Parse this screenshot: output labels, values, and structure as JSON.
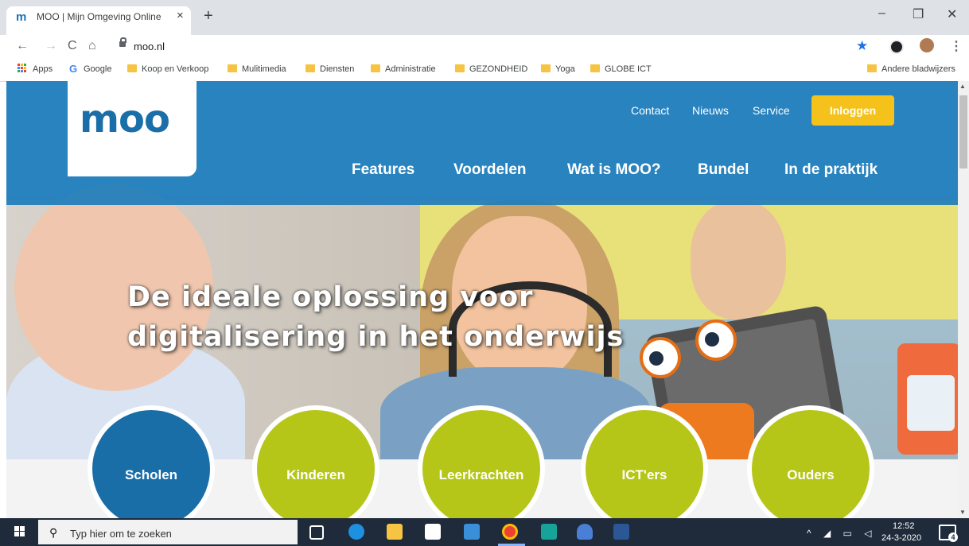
{
  "browser": {
    "tab_title": "MOO | Mijn Omgeving Online",
    "tab_favicon": "m",
    "tab_close": "×",
    "new_tab": "+",
    "url": "moo.nl",
    "window_controls": {
      "minimize": "–",
      "maximize": "❐",
      "close": "✕"
    },
    "nav": {
      "back": "←",
      "forward": "→",
      "reload": "C",
      "home": "⌂"
    },
    "star": "★",
    "menu": "⋮"
  },
  "bookmarks": {
    "apps": "Apps",
    "google": "Google",
    "items": [
      "Koop en Verkoop",
      "Mulitimedia",
      "Diensten",
      "Administratie",
      "GEZONDHEID",
      "Yoga",
      "GLOBE ICT"
    ],
    "other": "Andere bladwijzers"
  },
  "site": {
    "logo": "moo",
    "top_nav": [
      "Contact",
      "Nieuws",
      "Service"
    ],
    "login": "Inloggen",
    "main_nav": [
      "Features",
      "Voordelen",
      "Wat is MOO?",
      "Bundel",
      "In de praktijk"
    ],
    "headline": [
      "De ideale oplossing voor",
      "digitalisering in het onderwijs"
    ],
    "audience": [
      "Scholen",
      "Kinderen",
      "Leerkrachten",
      "ICT'ers",
      "Ouders"
    ]
  },
  "taskbar": {
    "search_placeholder": "Typ hier om te zoeken",
    "time": "12:52",
    "date": "24-3-2020",
    "notifications": "4"
  },
  "colors": {
    "brand_blue": "#1b75bb",
    "header_blue": "#1e7dbc",
    "login_yellow": "#f4c21b",
    "circle_green": "#b5c619",
    "circle_blue": "#1a6ea8"
  }
}
